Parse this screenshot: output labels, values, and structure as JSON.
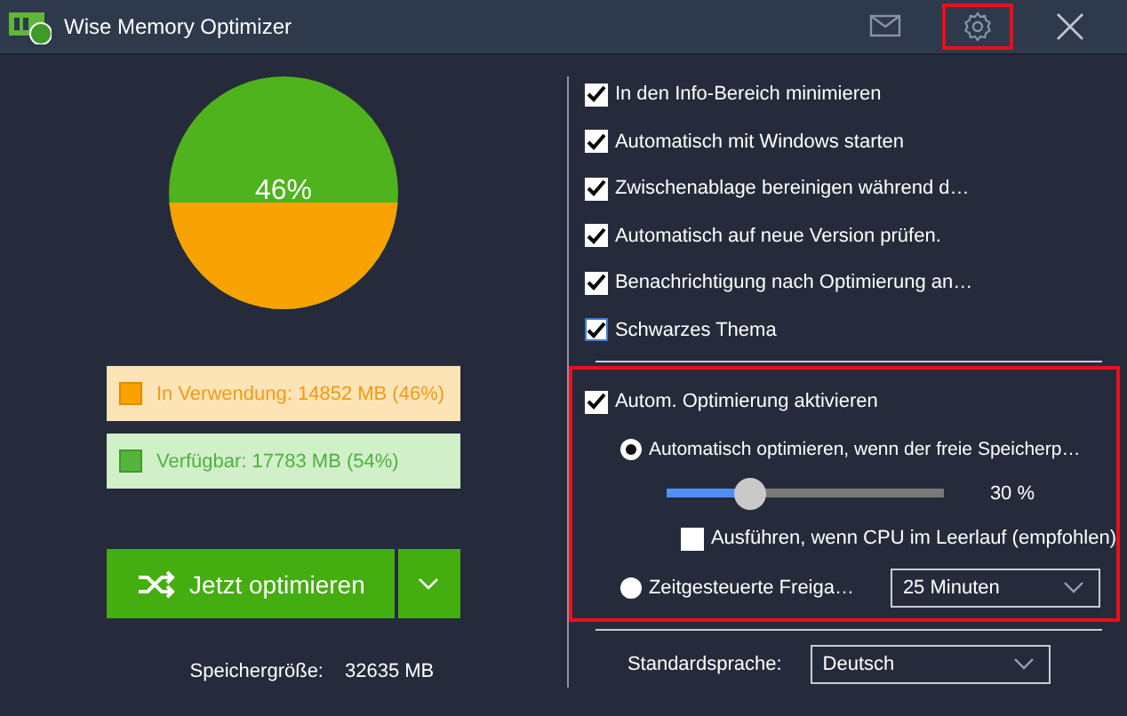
{
  "window": {
    "title": "Wise Memory Optimizer",
    "buttons": [
      {
        "kind": "mail",
        "highlighted": false
      },
      {
        "kind": "settings",
        "highlighted": true
      },
      {
        "kind": "close",
        "highlighted": false
      }
    ]
  },
  "memory": {
    "gauge": {
      "level": 0.46,
      "reading": "46%"
    },
    "legend": [
      {
        "kind": "used",
        "label": "In Verwendung: 14852 MB (46%)"
      },
      {
        "kind": "free",
        "label": "Verfügbar: 17783 MB (54%)"
      }
    ],
    "optimize_button": "Jetzt optimieren",
    "size_label": "Speichergröße:",
    "size_value": "32635 MB"
  },
  "options": [
    {
      "label": "In den Info-Bereich minimieren",
      "checked": true
    },
    {
      "label": "Automatisch mit Windows starten",
      "checked": true
    },
    {
      "label": "Zwischenablage bereinigen während d…",
      "checked": true
    },
    {
      "label": "Automatisch auf neue Version prüfen.",
      "checked": true
    },
    {
      "label": "Benachrichtigung nach Optimierung an…",
      "checked": true
    },
    {
      "label": "Schwarzes Thema",
      "checked": true
    }
  ],
  "auto": {
    "highlighted": true,
    "enable": {
      "label": "Autom. Optimierung aktivieren",
      "checked": true
    },
    "threshold": {
      "label": "Automatisch optimieren, wenn der freie Speicherp…",
      "selected": true,
      "level": 0.3,
      "reading": "30 %"
    },
    "idle": {
      "label": "Ausführen, wenn CPU im Leerlauf (empfohlen)",
      "checked": false
    },
    "timed": {
      "label": "Zeitgesteuerte Freiga…",
      "selected": false,
      "value": "25 Minuten"
    }
  },
  "language": {
    "label": "Standardsprache:",
    "value": "Deutsch"
  }
}
